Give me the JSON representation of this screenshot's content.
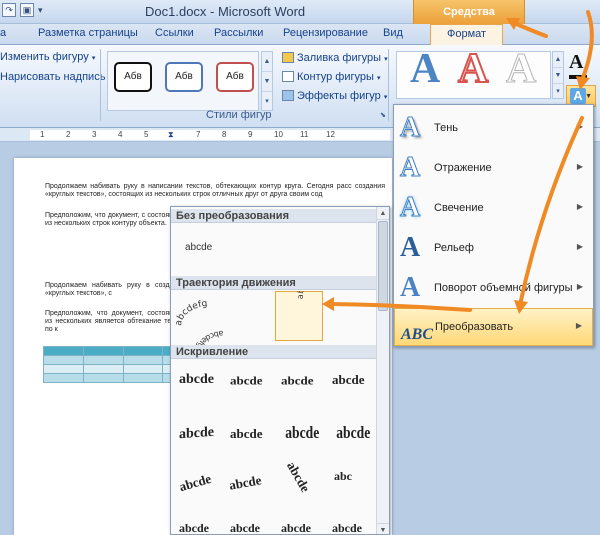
{
  "window": {
    "doc_title": "Doc1.docx  -  Microsoft Word",
    "context_tab_title": "Средства рисования",
    "qat_word_icon": "W"
  },
  "tabs": [
    {
      "label": "а"
    },
    {
      "label": "Разметка страницы"
    },
    {
      "label": "Ссылки"
    },
    {
      "label": "Рассылки"
    },
    {
      "label": "Рецензирование"
    },
    {
      "label": "Вид"
    },
    {
      "label": "Формат"
    }
  ],
  "ribbon": {
    "edit_shape": "Изменить фигуру",
    "draw_text": "Нарисовать надпись",
    "shape_styles": {
      "label": "Стили фигур",
      "samples": [
        "Абв",
        "Абв",
        "Абв"
      ],
      "fill": "Заливка фигуры",
      "outline": "Контур фигуры",
      "effects": "Эффекты фигур"
    },
    "wordart_letter": "A",
    "text_effect_letter": "A"
  },
  "ruler": {
    "ticks": [
      "1",
      "2",
      "3",
      "4",
      "5",
      "6",
      "7",
      "8",
      "9",
      "10",
      "11",
      "12"
    ]
  },
  "document": {
    "para1": "Продолжаем набивать руку в написании текстов, обтекающих контур круга. Сегодня расс создания «круглых текстов», состоящих из нескольких строк отличных друг от друга своим сод",
    "para2": "Предположим, что документ, с состоящего из нескольких строк контуру объекта.",
    "para3": "Продолжаем набивать руку в создания «круглых текстов», с",
    "para4": "Предположим, что документ, состоящего из нескольких является обтекание текста по к"
  },
  "transform_gallery": {
    "no_transform_header": "Без преобразования",
    "plain_sample": "abcde",
    "path_header": "Траектория движения",
    "warp_header": "Искривление",
    "path_samples": [
      "abcdefg",
      "abcdefghijkl",
      "abcdefghijkl"
    ],
    "warp_samples": [
      "abcde",
      "abcde",
      "abcde",
      "abcde",
      "abcde",
      "abcde",
      "abcde",
      "abcde",
      "abcde",
      "abcde",
      "abcde",
      "abc",
      "abcde",
      "abcde",
      "abcde",
      "abcde"
    ]
  },
  "text_effects_menu": [
    {
      "label": "Тень",
      "color": "#6aa7dc"
    },
    {
      "label": "Отражение",
      "color": "#3d7fc4"
    },
    {
      "label": "Свечение",
      "color": "#5ab4e8"
    },
    {
      "label": "Рельеф",
      "color": "#2c5f9a"
    },
    {
      "label": "Поворот объемной фигуры",
      "color": "#4a83c4"
    },
    {
      "label": "Преобразовать",
      "color": "#1f4f8c"
    }
  ],
  "colors": {
    "accent_orange": "#f08a24",
    "context_tab": "#eda03a",
    "selection": "#ffd877"
  }
}
